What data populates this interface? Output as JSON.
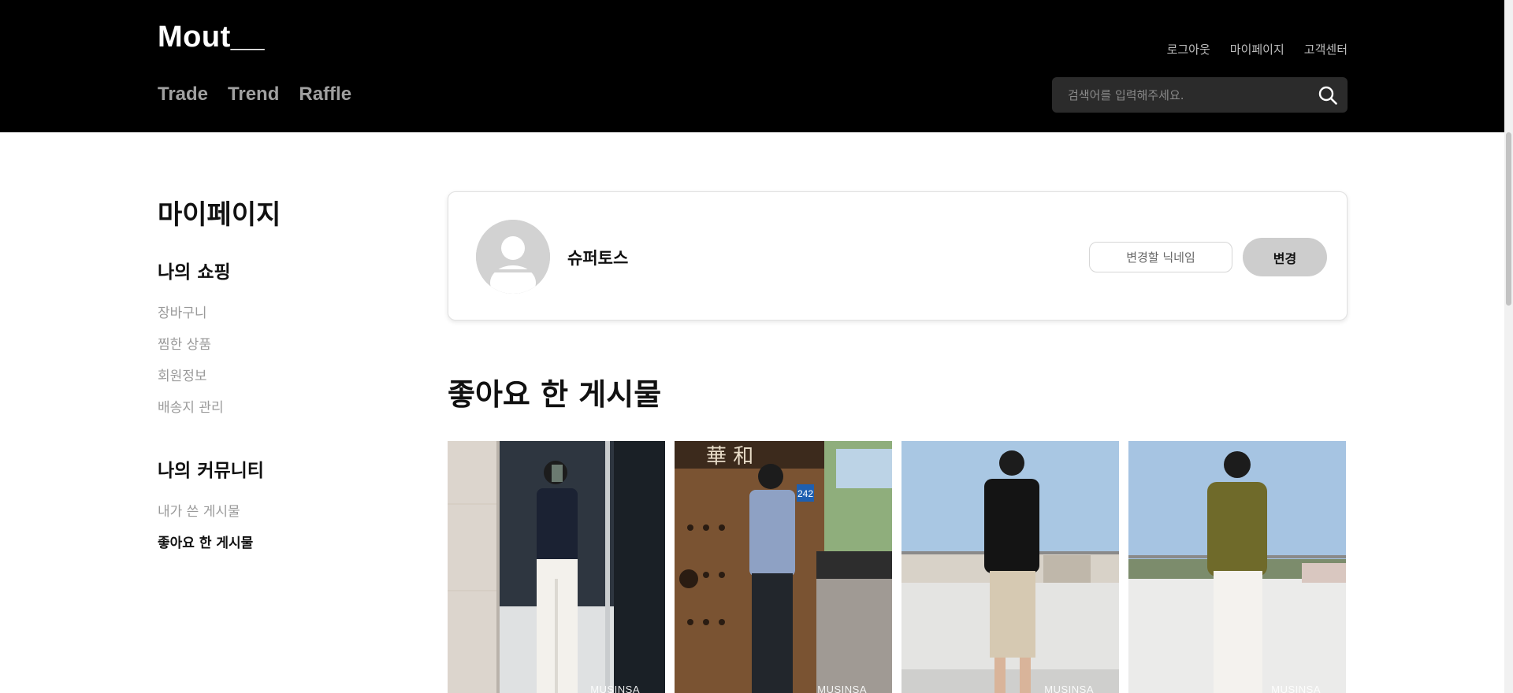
{
  "header": {
    "logo": "Mout__",
    "nav": [
      "Trade",
      "Trend",
      "Raffle"
    ],
    "util_links": [
      "로그아웃",
      "마이페이지",
      "고객센터"
    ],
    "search": {
      "placeholder": "검색어를 입력해주세요.",
      "icon": "search-icon"
    }
  },
  "sidebar": {
    "title": "마이페이지",
    "shopping": {
      "heading": "나의 쇼핑",
      "items": [
        "장바구니",
        "찜한 상품",
        "회원정보",
        "배송지 관리"
      ]
    },
    "community": {
      "heading": "나의 커뮤니티",
      "items": [
        "내가 쓴 게시물",
        "좋아요 한 게시물"
      ],
      "active_index": 1
    }
  },
  "profile": {
    "nickname": "슈퍼토스",
    "nickname_input_placeholder": "변경할 닉네임",
    "change_button": "변경",
    "avatar_icon": "default-user-avatar-icon"
  },
  "liked_posts": {
    "title": "좋아요 한 게시물",
    "posts": [
      {
        "watermark": "MUSINSA",
        "sign_text": ""
      },
      {
        "watermark": "MUSINSA",
        "sign_text": "華 和",
        "plate_text": "242"
      },
      {
        "watermark": "MUSINSA",
        "sign_text": ""
      },
      {
        "watermark": "MUSINSA",
        "sign_text": ""
      }
    ]
  },
  "colors": {
    "header_bg": "#000000",
    "nav_text": "#a0a0a0",
    "search_bg": "#2b2b2b",
    "button_bg": "#cdcdcd",
    "avatar_bg": "#d2d2d2",
    "active_text": "#111111",
    "inactive_text": "#9a9a9a"
  }
}
